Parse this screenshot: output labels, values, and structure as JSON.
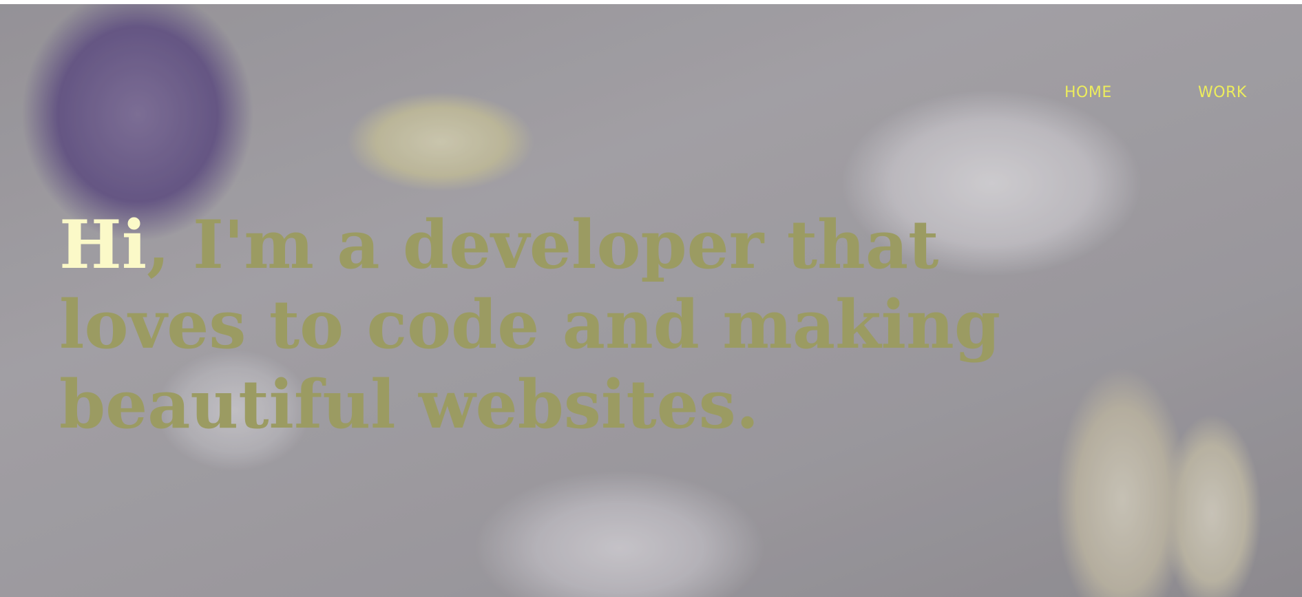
{
  "nav": {
    "items": [
      {
        "label": "HOME"
      },
      {
        "label": "WORK"
      }
    ]
  },
  "hero": {
    "greeting": "Hi",
    "message": ", I'm a developer that loves to code and making beautiful websites."
  },
  "colors": {
    "accent": "#eded5c",
    "greeting": "#fbf9c8",
    "headline": "#9b9b62"
  }
}
